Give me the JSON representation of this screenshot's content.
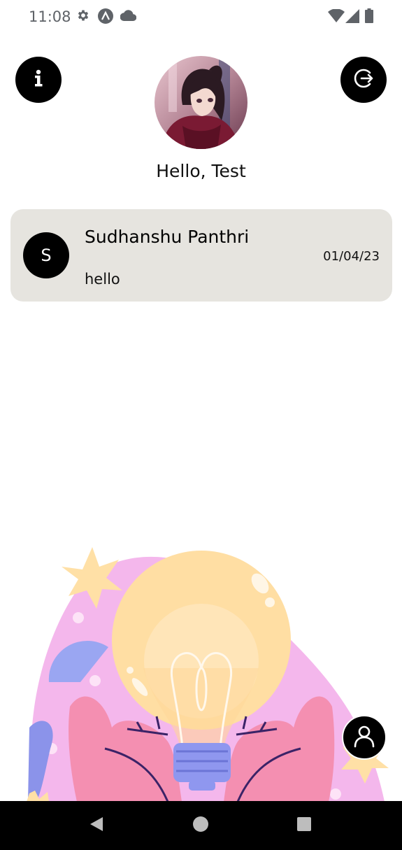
{
  "status_bar": {
    "time": "11:08",
    "icons": [
      "settings-icon",
      "app-logo-icon",
      "cloud-icon",
      "wifi-icon",
      "signal-icon",
      "battery-icon"
    ]
  },
  "header": {
    "info_icon": "info-icon",
    "logout_icon": "logout-icon",
    "greeting": "Hello, Test"
  },
  "chats": [
    {
      "avatar_letter": "S",
      "name": "Sudhanshu Panthri",
      "date": "01/04/23",
      "last_message": "hello"
    }
  ],
  "fab": {
    "icon": "user-icon"
  },
  "nav": {
    "icons": [
      "back-icon",
      "home-icon",
      "recents-icon"
    ]
  },
  "colors": {
    "card_bg": "#e6e4df",
    "button_bg": "#000000",
    "status_text": "#5f6368"
  }
}
